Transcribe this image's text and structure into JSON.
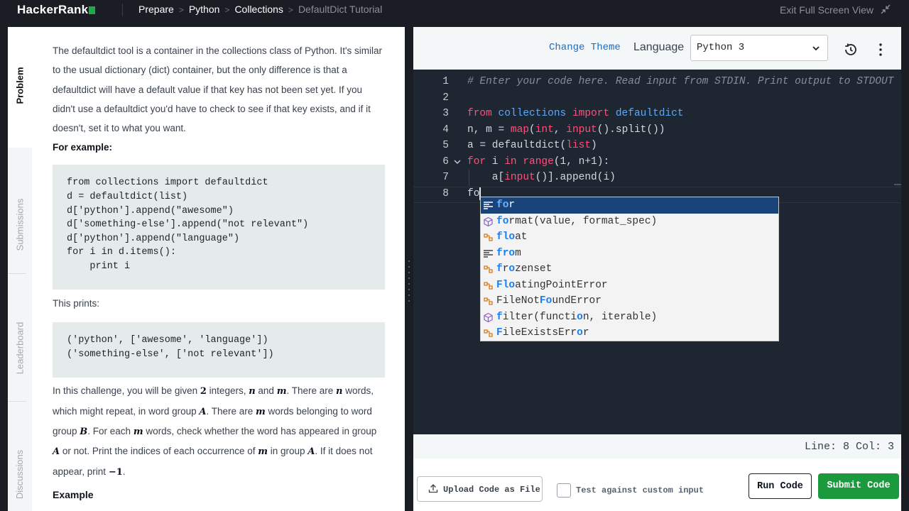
{
  "header": {
    "logo": "HackerRank",
    "breadcrumbs": [
      "Prepare",
      "Python",
      "Collections",
      "DefaultDict Tutorial"
    ],
    "exit_fullscreen": "Exit Full Screen View"
  },
  "sidebar": {
    "tabs": [
      "Problem",
      "Submissions",
      "Leaderboard",
      "Discussions"
    ]
  },
  "problem": {
    "intro": "The defaultdict tool is a container in the collections class of Python. It's similar to the usual dictionary (dict) container, but the only difference is that a defaultdict will have a default value if that key has not been set yet. If you didn't use a defaultdict you'd have to check to see if that key exists, and if it doesn't, set it to what you want.",
    "for_example": "For example:",
    "example_code": "from collections import defaultdict\nd = defaultdict(list)\nd['python'].append(\"awesome\")\nd['something-else'].append(\"not relevant\")\nd['python'].append(\"language\")\nfor i in d.items():\n    print i",
    "this_prints": "This prints:",
    "output_code": "('python', ['awesome', 'language'])\n('something-else', ['not relevant'])",
    "challenge": {
      "p1": "In this challenge, you will be given ",
      "two": "2",
      "p2": " integers, ",
      "n": "n",
      "p3": " and ",
      "m": "m",
      "p4": ". There are ",
      "p5": " words, which might repeat, in word group ",
      "A": "A",
      "p6": ". There are ",
      "p7": " words belonging to word group ",
      "B": "B",
      "p8": ". For each ",
      "p9": " words, check whether the word has appeared in group ",
      "p10": " or not. Print the indices of each occurrence of ",
      "p11": " in group ",
      "p12": ". If it does not appear, print ",
      "neg1": "−1",
      "p13": "."
    },
    "example_heading": "Example"
  },
  "editor_toolbar": {
    "change_theme": "Change Theme",
    "language_label": "Language",
    "language_value": "Python 3"
  },
  "editor": {
    "line_numbers": [
      "1",
      "2",
      "3",
      "4",
      "5",
      "6",
      "7",
      "8"
    ],
    "line1": "# Enter your code here. Read input from STDIN. Print output to STDOUT",
    "line3": {
      "from": "from",
      "mod": " collections ",
      "import": "import",
      "name": " defaultdict"
    },
    "line4": {
      "a": "n, m = ",
      "map": "map",
      "b": "(",
      "int": "int",
      "c": ", ",
      "input": "input",
      "d": "().split())"
    },
    "line5": {
      "a": "a = defaultdict(",
      "list": "list",
      "b": ")"
    },
    "line6": {
      "for": "for",
      "a": " i ",
      "in": "in",
      "sp": " ",
      "range": "range",
      "b": "(1, n+1):"
    },
    "line7": {
      "a": "    a[",
      "input": "input",
      "b": "()].append(i)"
    },
    "line8": "fo",
    "suggestions": [
      {
        "icon": "keyword-icon",
        "hl": "fo",
        "rest": "r"
      },
      {
        "icon": "function-icon",
        "hl": "fo",
        "rest": "rmat(value, format_spec)"
      },
      {
        "icon": "class-icon",
        "parts": [
          "f",
          "l",
          "o",
          "at"
        ]
      },
      {
        "icon": "keyword-icon",
        "parts": [
          "f",
          "r",
          "o",
          "m"
        ]
      },
      {
        "icon": "class-icon",
        "parts": [
          "f",
          "r",
          "o",
          "zenset"
        ]
      },
      {
        "icon": "class-icon",
        "parts": [
          "F",
          "l",
          "o",
          "atingPointError"
        ]
      },
      {
        "icon": "class-icon",
        "parts": [
          "F",
          "ileNot",
          "Fo",
          "undError"
        ]
      },
      {
        "icon": "function-icon",
        "parts": [
          "f",
          "ilter(functi",
          "o",
          "n, iterable)"
        ]
      },
      {
        "icon": "class-icon",
        "parts": [
          "F",
          "ileExistsErr",
          "o",
          "r"
        ]
      }
    ]
  },
  "status": {
    "position": "Line: 8 Col: 3"
  },
  "actions": {
    "upload": "Upload Code as File",
    "custom_input": "Test against custom input",
    "run": "Run Code",
    "submit": "Submit Code"
  },
  "colors": {
    "submit": "#1a9a3d",
    "accent": "#1b6bc6",
    "logo_square": "#1ba94c"
  }
}
